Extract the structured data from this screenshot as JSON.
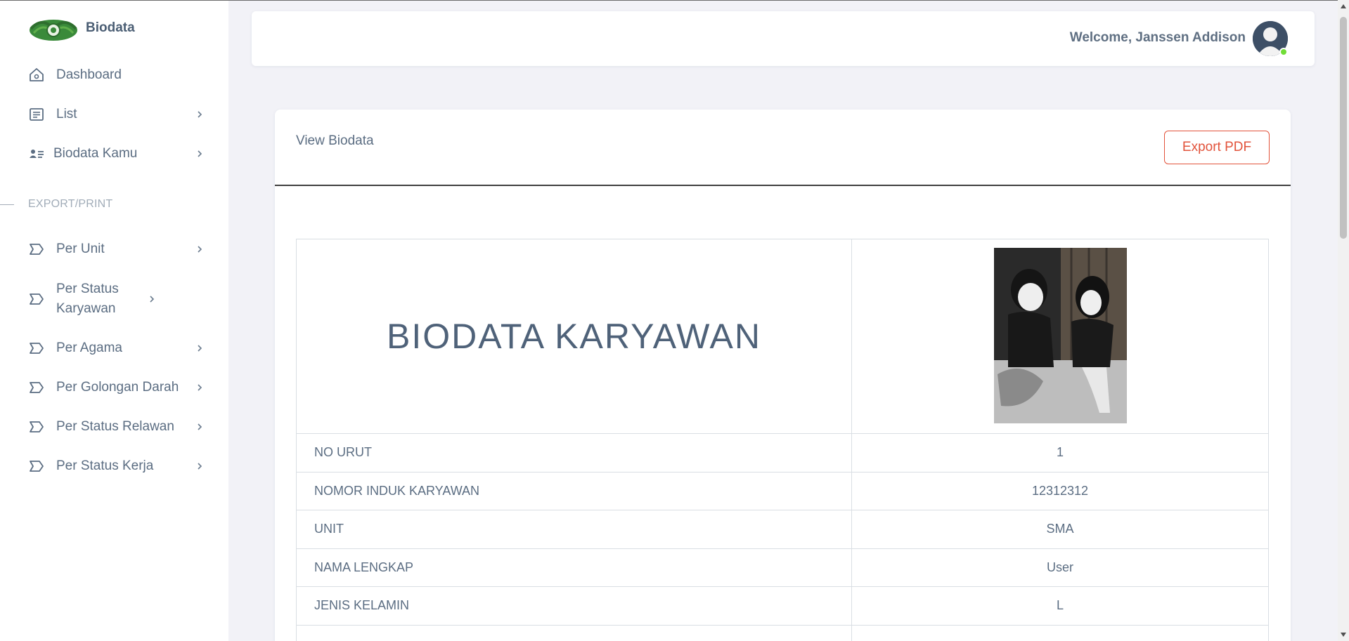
{
  "brand": {
    "name": "Biodata"
  },
  "sidebar": {
    "items": [
      {
        "label": "Dashboard",
        "icon": "home-icon",
        "has_chevron": false
      },
      {
        "label": "List",
        "icon": "list-icon",
        "has_chevron": true
      },
      {
        "label": "Biodata Kamu",
        "icon": "user-card-icon",
        "has_chevron": true
      }
    ],
    "section_header": "EXPORT/PRINT",
    "export_items": [
      {
        "label": "Per Unit",
        "icon": "tag-icon"
      },
      {
        "label": "Per Status Karyawan",
        "icon": "tag-icon"
      },
      {
        "label": "Per Agama",
        "icon": "tag-icon"
      },
      {
        "label": "Per Golongan Darah",
        "icon": "tag-icon"
      },
      {
        "label": "Per Status Relawan",
        "icon": "tag-icon"
      },
      {
        "label": "Per Status Kerja",
        "icon": "tag-icon"
      }
    ]
  },
  "navbar": {
    "welcome": "Welcome, Janssen Addison",
    "status_color": "#71dd37"
  },
  "card": {
    "title": "View Biodata",
    "export_label": "Export PDF",
    "accent_color": "#e2533b"
  },
  "biodata": {
    "heading": "BIODATA KARYAWAN",
    "rows": [
      {
        "label": "NO URUT",
        "value": "1"
      },
      {
        "label": "NOMOR INDUK KARYAWAN",
        "value": "12312312"
      },
      {
        "label": "UNIT",
        "value": "SMA"
      },
      {
        "label": "NAMA LENGKAP",
        "value": "User"
      },
      {
        "label": "JENIS KELAMIN",
        "value": "L"
      }
    ]
  }
}
